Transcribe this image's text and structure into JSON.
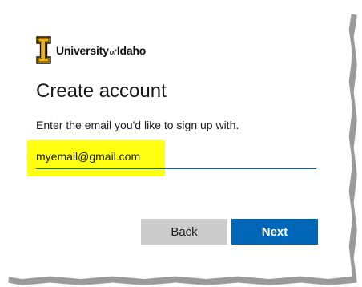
{
  "brand": {
    "name_part1": "University",
    "name_part2": "of",
    "name_part3": "Idaho",
    "logo_icon": "university-of-idaho-i-logo",
    "logo_color": "#f1b300"
  },
  "page": {
    "title": "Create account",
    "subtitle": "Enter the email you'd like to sign up with."
  },
  "email_field": {
    "value": "myemail@gmail.com",
    "highlight_color": "#ffff12"
  },
  "buttons": {
    "back_label": "Back",
    "next_label": "Next",
    "primary_color": "#0067b8",
    "secondary_color": "#cccccc"
  }
}
